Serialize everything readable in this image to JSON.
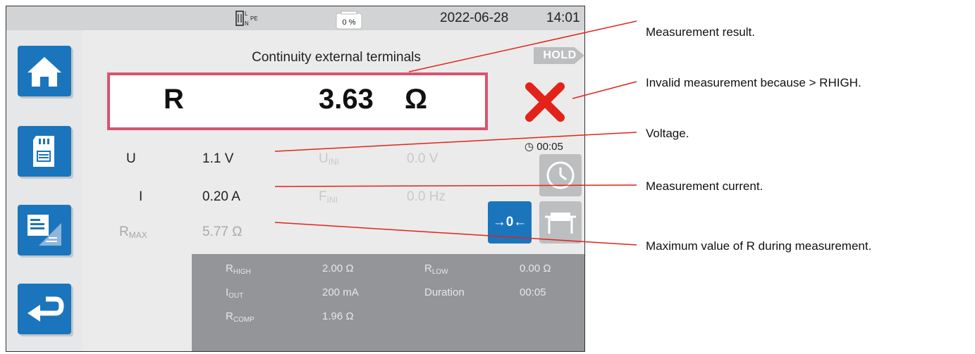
{
  "status_bar": {
    "plug_labels": {
      "l": "L",
      "n": "N",
      "pe": "PE"
    },
    "battery_percent": "0 %",
    "date": "2022-06-28",
    "time": "14:01"
  },
  "sidebar": {
    "items": [
      {
        "name": "home",
        "icon": "home-icon"
      },
      {
        "name": "memory",
        "icon": "sd-card-icon"
      },
      {
        "name": "configuration",
        "icon": "settings-sheet-icon"
      },
      {
        "name": "back",
        "icon": "return-arrow-icon"
      }
    ]
  },
  "measurement": {
    "title": "Continuity external terminals",
    "hold_label": "HOLD",
    "result": {
      "name": "R",
      "value": "3.63",
      "unit": "Ω"
    },
    "fail_icon": "red-cross-icon",
    "rows": {
      "u": {
        "label": "U",
        "value": "1.1 V"
      },
      "uini": {
        "label_main": "U",
        "label_sub": "INI",
        "value": "0.0 V"
      },
      "i": {
        "label": "I",
        "value": "0.20 A"
      },
      "fini": {
        "label_main": "F",
        "label_sub": "INI",
        "value": "0.0 Hz"
      },
      "rmax": {
        "label_main": "R",
        "label_sub": "MAX",
        "value": "5.77 Ω"
      }
    },
    "timer": {
      "icon": "stopwatch-icon",
      "value": "00:05"
    },
    "zero_button": "→0←"
  },
  "config_panel": {
    "rhigh": {
      "label_main": "R",
      "label_sub": "HIGH",
      "value": "2.00 Ω"
    },
    "rlow": {
      "label_main": "R",
      "label_sub": "LOW",
      "value": "0.00 Ω"
    },
    "iout": {
      "label_main": "I",
      "label_sub": "OUT",
      "value": "200 mA"
    },
    "duration": {
      "label": "Duration",
      "value": "00:05"
    },
    "rcomp": {
      "label_main": "R",
      "label_sub": "COMP",
      "value": "1.96 Ω"
    }
  },
  "annotations": {
    "result": "Measurement result.",
    "invalid_prefix": "Invalid measurement because > R",
    "invalid_suffix": "HIGH.",
    "voltage": "Voltage.",
    "current": "Measurement current.",
    "rmax": "Maximum value of R during measurement."
  },
  "colors": {
    "accent_blue": "#1b75bc",
    "result_border": "#d9536f",
    "fail_red": "#e2231a",
    "annotation_line": "#e2231a",
    "panel_gray": "#939598"
  }
}
